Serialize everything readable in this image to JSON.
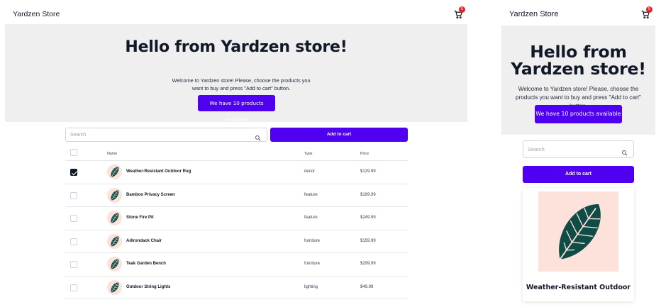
{
  "header": {
    "brand": "Yardzen Store",
    "cart_count": "5",
    "cart_icon": "shopping-cart-icon"
  },
  "hero": {
    "title": "Hello from Yardzen store!",
    "description": "Welcome to Yardzen store! Please, choose the products you want to buy and press \"Add to cart\" button.",
    "products_button": "We have 10 products available"
  },
  "toolbar": {
    "search_placeholder": "Search",
    "search_icon": "search-icon",
    "add_to_cart": "Add to cart"
  },
  "table": {
    "headers": {
      "name": "Name",
      "type": "Type",
      "price": "Price"
    },
    "rows": [
      {
        "name": "Weather-Resistant Outdoor Rug",
        "type": "decor",
        "price": "$129.99",
        "checked": true
      },
      {
        "name": "Bamboo Privacy Screen",
        "type": "feature",
        "price": "$189.99",
        "checked": false
      },
      {
        "name": "Stone Fire Pit",
        "type": "feature",
        "price": "$249.99",
        "checked": false
      },
      {
        "name": "Adirondack Chair",
        "type": "furniture",
        "price": "$159.99",
        "checked": false
      },
      {
        "name": "Teak Garden Bench",
        "type": "furniture",
        "price": "$299.99",
        "checked": false
      },
      {
        "name": "Outdoor String Lights",
        "type": "lighting",
        "price": "$49.99",
        "checked": false
      }
    ]
  },
  "card": {
    "title": "Weather-Resistant Outdoor"
  },
  "colors": {
    "accent": "#4f00f0",
    "badge": "#dc2626",
    "hero_bg": "#efefef",
    "thumb_bg": "#fde2dc",
    "leaf": "#0f4c45"
  }
}
